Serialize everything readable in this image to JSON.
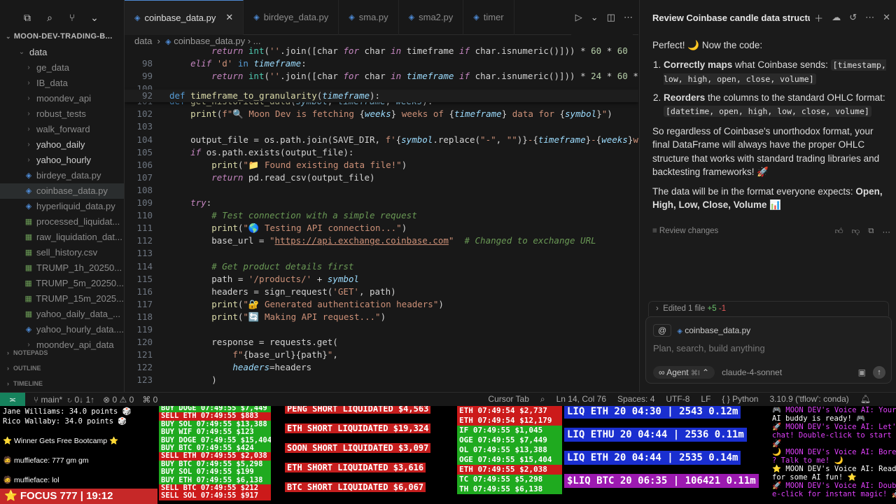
{
  "explorer": {
    "repo": "MOON-DEV-TRADING-B...",
    "root_folder": "data",
    "items": [
      {
        "label": "ge_data",
        "kind": "folder"
      },
      {
        "label": "IB_data",
        "kind": "folder"
      },
      {
        "label": "moondev_api",
        "kind": "folder"
      },
      {
        "label": "robust_tests",
        "kind": "folder"
      },
      {
        "label": "walk_forward",
        "kind": "folder"
      },
      {
        "label": "yahoo_daily",
        "kind": "folder"
      },
      {
        "label": "yahoo_hourly",
        "kind": "folder"
      },
      {
        "label": "birdeye_data.py",
        "kind": "py"
      },
      {
        "label": "coinbase_data.py",
        "kind": "py"
      },
      {
        "label": "hyperliquid_data.py",
        "kind": "py"
      },
      {
        "label": "processed_liquidat...",
        "kind": "csv"
      },
      {
        "label": "raw_liquidation_dat...",
        "kind": "csv"
      },
      {
        "label": "sell_history.csv",
        "kind": "csv"
      },
      {
        "label": "TRUMP_1h_20250...",
        "kind": "csv"
      },
      {
        "label": "TRUMP_5m_20250...",
        "kind": "csv"
      },
      {
        "label": "TRUMP_15m_2025...",
        "kind": "csv"
      },
      {
        "label": "yahoo_daily_data_...",
        "kind": "csv"
      },
      {
        "label": "yahoo_hourly_data....",
        "kind": "py"
      },
      {
        "label": "moondev_api_data",
        "kind": "folder"
      }
    ],
    "sections": [
      "NOTEPADS",
      "OUTLINE",
      "TIMELINE"
    ]
  },
  "tabs": [
    {
      "label": "coinbase_data.py",
      "active": true
    },
    {
      "label": "birdeye_data.py",
      "active": false
    },
    {
      "label": "sma.py",
      "active": false
    },
    {
      "label": "sma2.py",
      "active": false
    },
    {
      "label": "timer",
      "active": false
    }
  ],
  "breadcrumb": {
    "folder": "data",
    "file": "coinbase_data.py",
    "rest": "..."
  },
  "code": {
    "sticky_line": "92",
    "lines": [
      "98",
      "99",
      "100",
      "101",
      "102",
      "103",
      "104",
      "105",
      "106",
      "107",
      "108",
      "109",
      "110",
      "111",
      "112",
      "113",
      "114",
      "115",
      "116",
      "117",
      "118",
      "119",
      "120",
      "121",
      "122",
      "123"
    ]
  },
  "chat": {
    "title": "Review Coinbase candle data structu",
    "intro": "Perfect! 🌙 Now the code:",
    "point1_bold": "Correctly maps",
    "point1_text": " what Coinbase sends: ",
    "point1_code": "[timestamp, low, high, open, close, volume]",
    "point2_bold": "Reorders",
    "point2_text": " the columns to the standard OHLC format: ",
    "point2_code": "[datetime, open, high, low, close, volume]",
    "para1": "So regardless of Coinbase's unorthodox format, your final DataFrame will always have the proper OHLC structure that works with standard trading libraries and backtesting frameworks! 🚀",
    "para2_text": "The data will be in the format everyone expects: ",
    "para2_bold": "Open, High, Low, Close, Volume",
    "para2_emoji": " 📊",
    "review": "Review changes",
    "edited": "Edited 1 file",
    "edited_plus": "+5",
    "edited_minus": "-1",
    "context_file": "coinbase_data.py",
    "placeholder": "Plan, search, build anything",
    "mode": "Agent",
    "mode_shortcut": "⌘I",
    "model": "claude-4-sonnet"
  },
  "status": {
    "branch": "main*",
    "sync": "0↓ 1↑",
    "errors": "0",
    "warnings": "0",
    "ports": "0",
    "cursor_tab": "Cursor Tab",
    "position": "Ln 14, Col 76",
    "spaces": "Spaces: 4",
    "encoding": "UTF-8",
    "eol": "LF",
    "language": "Python",
    "interpreter": "3.10.9 ('tflow': conda)"
  },
  "stream": {
    "chat_lines": [
      "Jane Williams: 34.0 points 🎲",
      "Rico Wallaby: 34.0 points 🎲",
      "",
      "⭐ Winner Gets Free Bootcamp ⭐",
      "",
      "🧔 muffieface: 777 gm gm",
      "",
      "🧔 muffieface: lol"
    ],
    "focus": "⭐ FOCUS 777 | 19:12",
    "trades": [
      {
        "t": "BUY DOGE 07:49:55 $7,449",
        "c": "g"
      },
      {
        "t": "SELL ETH 07:49:55 $883",
        "c": "r"
      },
      {
        "t": "BUY SOL 07:49:55 $13,388",
        "c": "g"
      },
      {
        "t": "BUY WIF 07:49:55 $123",
        "c": "g"
      },
      {
        "t": "BUY DOGE 07:49:55 $15,404",
        "c": "g"
      },
      {
        "t": "BUY BTC 07:49:55 $424",
        "c": "g"
      },
      {
        "t": "SELL ETH 07:49:55 $2,038",
        "c": "r"
      },
      {
        "t": "BUY BTC 07:49:55 $5,298",
        "c": "g"
      },
      {
        "t": "BUY SOL 07:49:55 $199",
        "c": "g"
      },
      {
        "t": "BUY ETH 07:49:55 $6,138",
        "c": "g"
      },
      {
        "t": "SELL BTC 07:49:55 $212",
        "c": "r"
      },
      {
        "t": "SELL SOL 07:49:55 $917",
        "c": "r"
      }
    ],
    "liquidations": [
      "PENG SHORT LIQUIDATED $4,563",
      "ETH SHORT LIQUIDATED $19,324",
      "SOON SHORT LIQUIDATED $3,097",
      "ETH SHORT LIQUIDATED $3,616",
      "BTC SHORT LIQUIDATED $6,067"
    ],
    "trades2": [
      {
        "t": "ETH 07:49:54 $2,737",
        "c": "r"
      },
      {
        "t": "ETH 07:49:54 $12,179",
        "c": "r"
      },
      {
        "t": "IF 07:49:55 $1,045",
        "c": "g"
      },
      {
        "t": "OGE 07:49:55 $7,449",
        "c": "g"
      },
      {
        "t": "OL 07:49:55 $13,388",
        "c": "g"
      },
      {
        "t": "OGE 07:49:55 $15,404",
        "c": "g"
      },
      {
        "t": "ETH 07:49:55 $2,038",
        "c": "r"
      },
      {
        "t": "TC 07:49:55 $5,298",
        "c": "g"
      },
      {
        "t": "TH 07:49:55 $6,138",
        "c": "g"
      }
    ],
    "big_liqs": [
      {
        "t": "LIQ ETH 20 04:30 | 2543 0.12m",
        "c": "#1a2fd0"
      },
      {
        "t": "LIQ ETHU 20 04:44 | 2536 0.11m",
        "c": "#1a2fd0"
      },
      {
        "t": "LIQ ETH 20 04:44 | 2535 0.14m",
        "c": "#1a2fd0"
      },
      {
        "t": "$LIQ BTC 20 06:35 | 106421 0.11m",
        "c": "#9c1ab0"
      }
    ],
    "voice": [
      {
        "t": "🎮 MOON DEV's Voice AI: Your",
        "c": "#e040fb"
      },
      {
        "t": "AI buddy is ready! 🎮",
        "c": "#ffffff"
      },
      {
        "t": "🚀 MOON DEV's Voice AI: Let'",
        "c": "#e040fb"
      },
      {
        "t": " chat! Double-click to start",
        "c": "#e040fb"
      },
      {
        "t": "🚀",
        "c": "#ffffff"
      },
      {
        "t": "🌙 MOON DEV's Voice AI: Bore",
        "c": "#e040fb"
      },
      {
        "t": "? Talk to me! 🌙",
        "c": "#e040fb"
      },
      {
        "t": "⭐ MOON DEV's Voice AI: Read",
        "c": "#ffffff"
      },
      {
        "t": " for some AI fun! ⭐",
        "c": "#ffffff"
      },
      {
        "t": "🚀 MOON DEV's Voice AI: Doub",
        "c": "#e040fb"
      },
      {
        "t": "e-click for instant magic! 🚀",
        "c": "#e040fb"
      }
    ]
  }
}
